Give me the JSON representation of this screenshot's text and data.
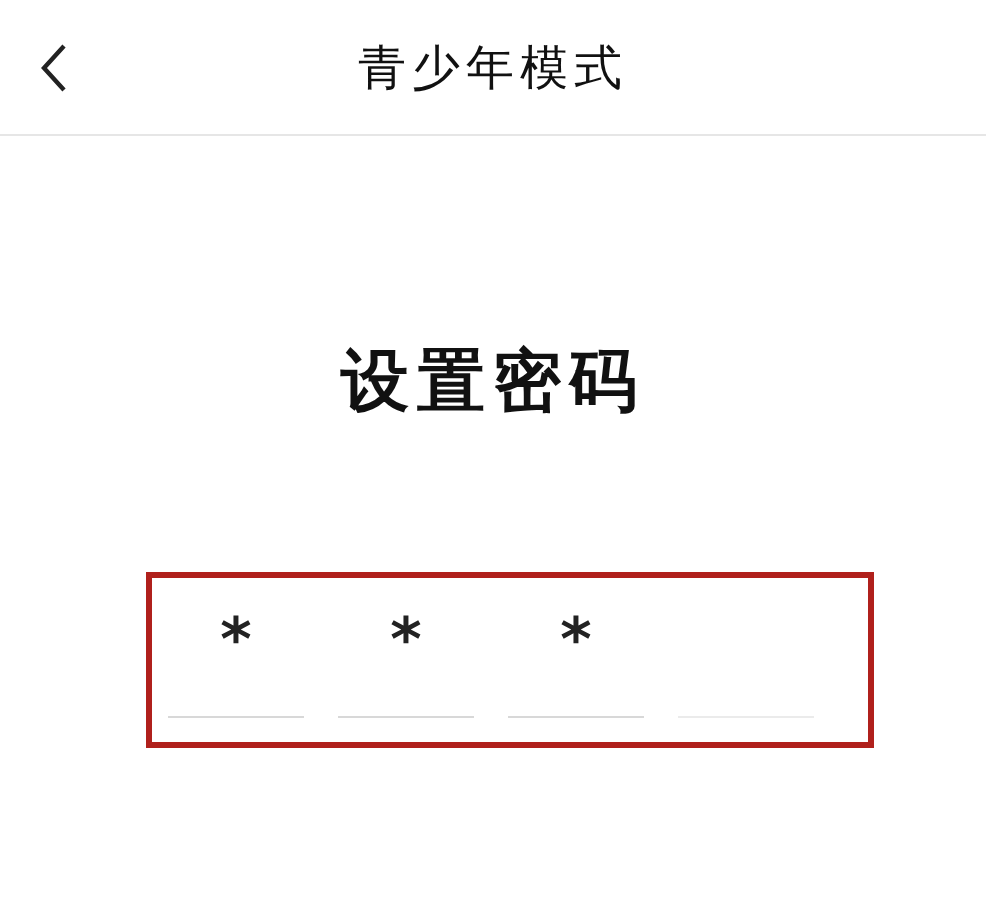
{
  "header": {
    "title": "青少年模式"
  },
  "heading": "设置密码",
  "password_fields": [
    {
      "filled": true,
      "value": "*"
    },
    {
      "filled": true,
      "value": "*"
    },
    {
      "filled": true,
      "value": "*"
    },
    {
      "filled": false
    }
  ],
  "highlight": {
    "color": "#b0201c"
  }
}
